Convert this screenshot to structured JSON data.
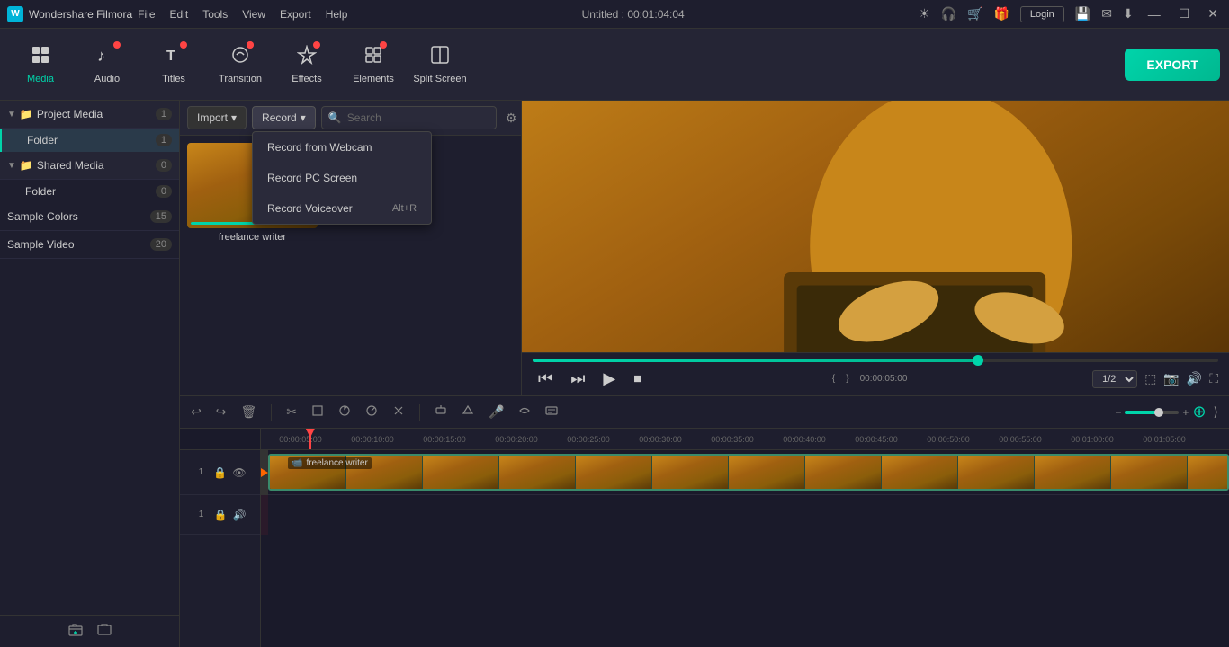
{
  "app": {
    "name": "Wondershare Filmora",
    "logo": "W",
    "title": "Untitled : 00:01:04:04"
  },
  "menu": {
    "items": [
      "File",
      "Edit",
      "Tools",
      "View",
      "Export",
      "Help"
    ]
  },
  "titlebar": {
    "buttons": {
      "minimize": "—",
      "maximize": "☐",
      "close": "✕"
    },
    "login": "Login"
  },
  "toolbar": {
    "items": [
      {
        "id": "media",
        "label": "Media",
        "icon": "⬛",
        "active": true,
        "badge": false
      },
      {
        "id": "audio",
        "label": "Audio",
        "icon": "🎵",
        "active": false,
        "badge": true
      },
      {
        "id": "titles",
        "label": "Titles",
        "icon": "T",
        "active": false,
        "badge": true
      },
      {
        "id": "transition",
        "label": "Transition",
        "icon": "⬡",
        "active": false,
        "badge": true
      },
      {
        "id": "effects",
        "label": "Effects",
        "icon": "✦",
        "active": false,
        "badge": true
      },
      {
        "id": "elements",
        "label": "Elements",
        "icon": "◈",
        "active": false,
        "badge": true
      },
      {
        "id": "splitscreen",
        "label": "Split Screen",
        "icon": "▦",
        "active": false,
        "badge": false
      }
    ],
    "export_label": "EXPORT"
  },
  "left_panel": {
    "sections": [
      {
        "id": "project_media",
        "label": "Project Media",
        "count": "1",
        "children": [
          {
            "label": "Folder",
            "count": "1",
            "selected": true
          }
        ]
      },
      {
        "id": "shared_media",
        "label": "Shared Media",
        "count": "0",
        "children": [
          {
            "label": "Folder",
            "count": "0",
            "selected": false
          }
        ]
      }
    ],
    "flat_items": [
      {
        "label": "Sample Colors",
        "count": "15"
      },
      {
        "label": "Sample Video",
        "count": "20"
      }
    ]
  },
  "media_panel": {
    "import_label": "Import",
    "record_label": "Record",
    "search_placeholder": "Search",
    "items": [
      {
        "name": "freelance writer"
      }
    ],
    "record_dropdown": {
      "items": [
        {
          "label": "Record from Webcam",
          "shortcut": ""
        },
        {
          "label": "Record PC Screen",
          "shortcut": ""
        },
        {
          "label": "Record Voiceover",
          "shortcut": "Alt+R"
        }
      ]
    }
  },
  "preview": {
    "progress": "65",
    "time_current": "00:00:05:00",
    "time_markers": [
      ""
    ],
    "ratio": "1/2",
    "playback": {
      "rewind": "⏮",
      "frame_back": "⏭",
      "play": "▶",
      "stop": "⏹"
    }
  },
  "timeline": {
    "toolbar_icons": [
      "↩",
      "↪",
      "🗑",
      "✂",
      "⬚",
      "◎",
      "⏱",
      "≡"
    ],
    "time_markers": [
      "00:00:05:00",
      "00:00:10:00",
      "00:00:15:00",
      "00:00:20:00",
      "00:00:25:00",
      "00:00:30:00",
      "00:00:35:00",
      "00:00:40:00",
      "00:00:45:00",
      "00:00:50:00",
      "00:00:55:00",
      "00:01:00:00",
      "00:01:05:00"
    ],
    "clip_label": "freelance writer",
    "track1_num": "1",
    "audio1_num": "1"
  }
}
